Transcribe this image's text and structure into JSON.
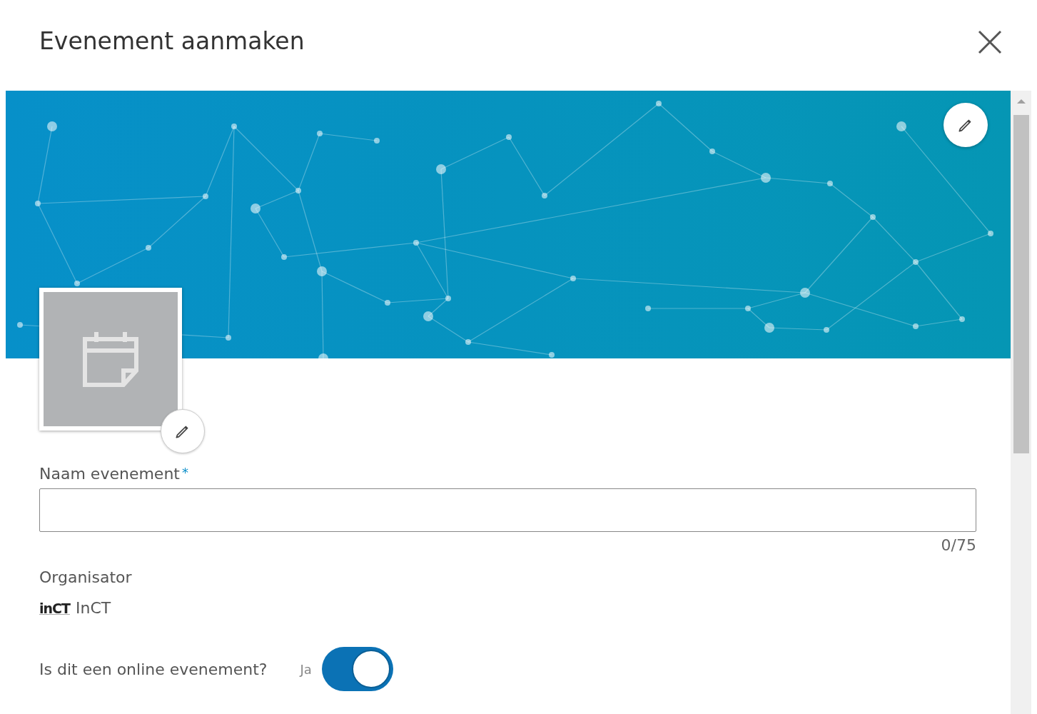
{
  "dialog": {
    "title": "Evenement aanmaken"
  },
  "form": {
    "name_field": {
      "label": "Naam evenement",
      "required_mark": "*",
      "counter": "0/75"
    },
    "organizer": {
      "label": "Organisator",
      "logo_text": "inCT",
      "name": "InCT"
    },
    "online": {
      "question": "Is dit een online evenement?",
      "state_label": "Ja",
      "on": true
    }
  }
}
